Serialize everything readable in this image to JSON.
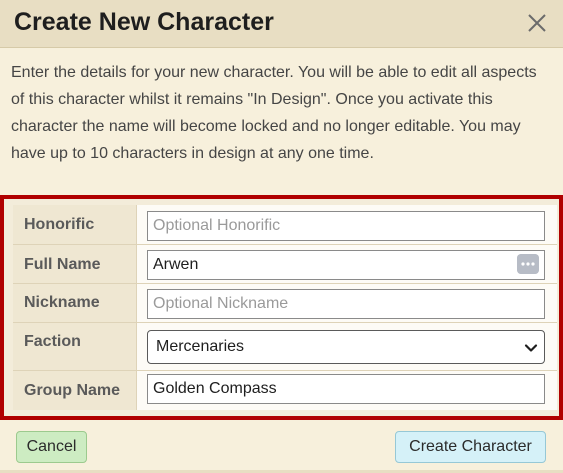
{
  "dialog": {
    "title": "Create New Character",
    "close_icon": "close-icon",
    "intro": "Enter the details for your new character. You will be able to edit all aspects of this character whilst it remains \"In Design\". Once you activate this character the name will become locked and no longer editable. You may have up to 10 characters in design at any one time."
  },
  "form": {
    "honorific": {
      "label": "Honorific",
      "value": "",
      "placeholder": "Optional Honorific"
    },
    "full_name": {
      "label": "Full Name",
      "value": "Arwen",
      "placeholder": "",
      "options_icon": "more-options-icon"
    },
    "nickname": {
      "label": "Nickname",
      "value": "",
      "placeholder": "Optional Nickname"
    },
    "faction": {
      "label": "Faction",
      "selected": "Mercenaries",
      "chevron_icon": "chevron-down-icon"
    },
    "group_name": {
      "label": "Group Name",
      "value": "Golden Compass",
      "placeholder": ""
    }
  },
  "footer": {
    "cancel_label": "Cancel",
    "create_label": "Create Character"
  },
  "colors": {
    "highlight_border": "#b00000",
    "cancel_bg": "#cdecc2",
    "create_bg": "#d5f1f8",
    "header_bg": "#e8dec3"
  }
}
